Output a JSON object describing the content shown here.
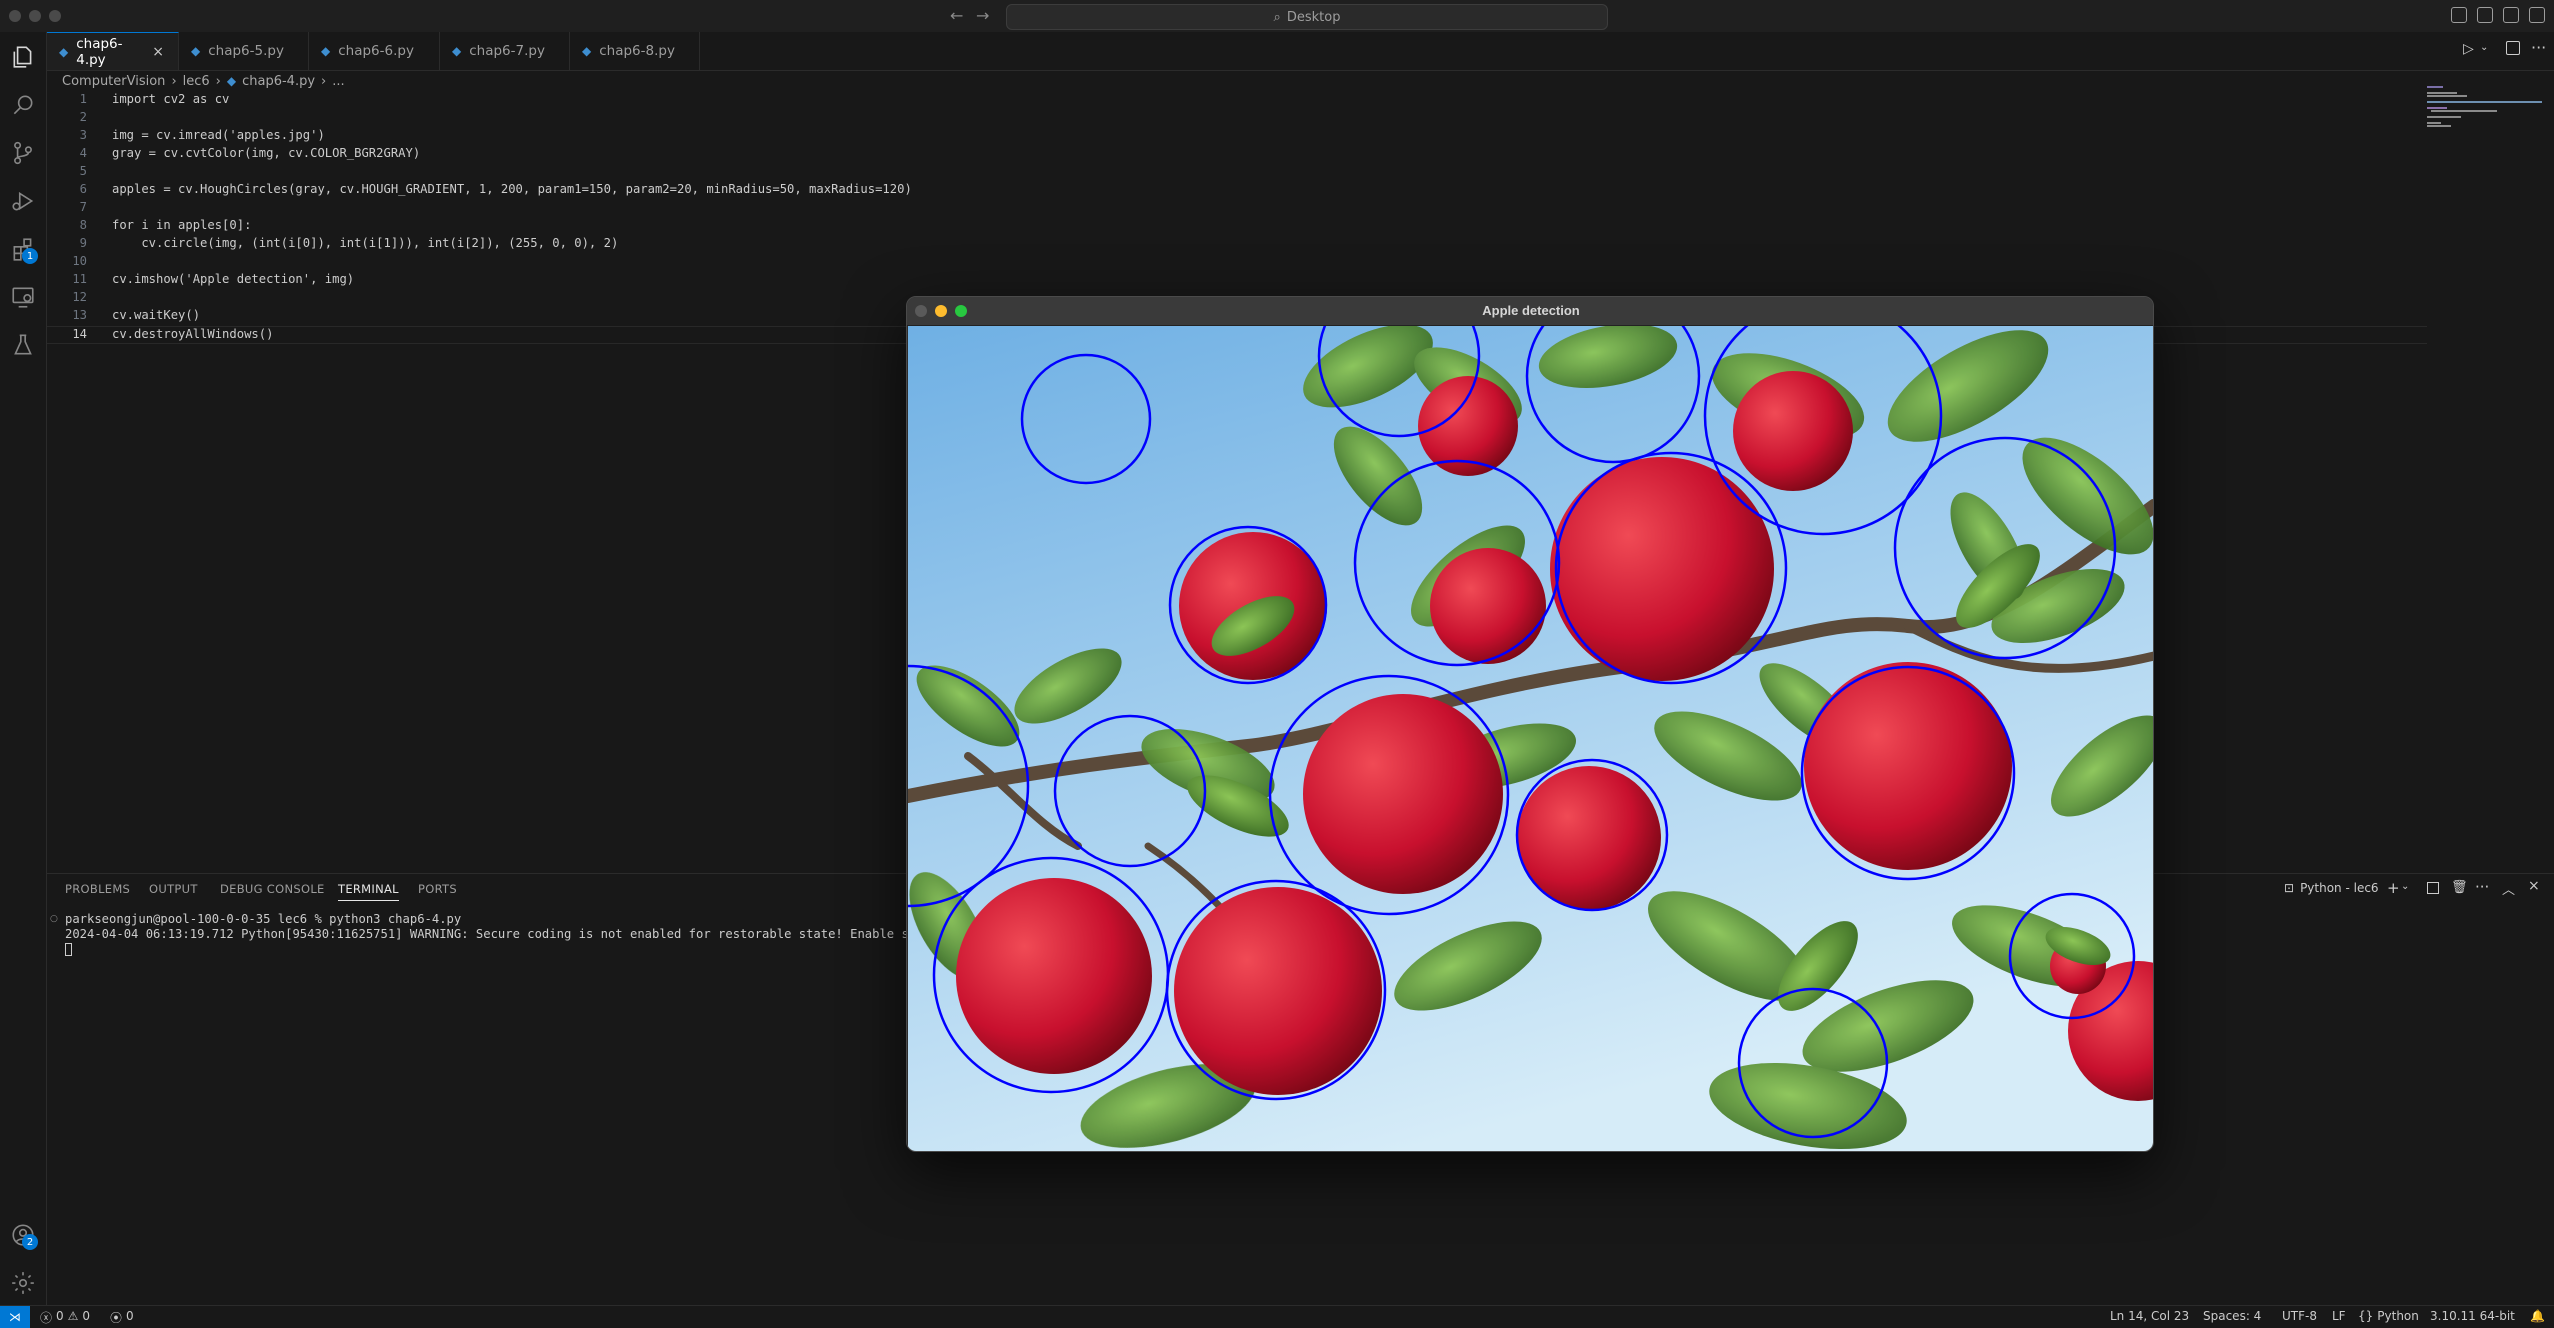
{
  "titlebar": {
    "search_placeholder": "Desktop"
  },
  "activity": {
    "extensions_badge": "1",
    "accounts_badge": "2"
  },
  "tabs": [
    {
      "label": "chap6-4.py",
      "active": true
    },
    {
      "label": "chap6-5.py"
    },
    {
      "label": "chap6-6.py"
    },
    {
      "label": "chap6-7.py"
    },
    {
      "label": "chap6-8.py"
    }
  ],
  "breadcrumb": {
    "folder": "ComputerVision",
    "subfolder": "lec6",
    "file": "chap6-4.py",
    "more": "..."
  },
  "code": {
    "l1": "import cv2 as cv",
    "l3": "img = cv.imread('apples.jpg')",
    "l4": "gray = cv.cvtColor(img, cv.COLOR_BGR2GRAY)",
    "l6": "apples = cv.HoughCircles(gray, cv.HOUGH_GRADIENT, 1, 200, param1=150, param2=20, minRadius=50, maxRadius=120)",
    "l8": "for i in apples[0]:",
    "l9": "    cv.circle(img, (int(i[0]), int(i[1])), int(i[2]), (255, 0, 0), 2)",
    "l11": "cv.imshow('Apple detection', img)",
    "l13": "cv.waitKey()",
    "l14": "cv.destroyAllWindows()"
  },
  "panel": {
    "tabs": [
      "PROBLEMS",
      "OUTPUT",
      "DEBUG CONSOLE",
      "TERMINAL",
      "PORTS"
    ],
    "active_tab": "TERMINAL",
    "terminal_profile": "Python - lec6",
    "terminal_lines": [
      "parkseongjun@pool-100-0-0-35 lec6 % python3 chap6-4.py",
      "2024-04-04 06:13:19.712 Python[95430:11625751] WARNING: Secure coding is not enabled for restorable state! Enable secure"
    ]
  },
  "window": {
    "title": "Apple detection"
  },
  "statusbar": {
    "errors": "0",
    "warnings": "0",
    "ports": "0",
    "position": "Ln 14, Col 23",
    "spaces": "Spaces: 4",
    "encoding": "UTF-8",
    "eol": "LF",
    "language": "Python",
    "interpreter": "3.10.11 64-bit"
  },
  "colors": {
    "accent": "#0078d4",
    "circle": "#0000ff",
    "apple": "#c8102e",
    "sky": "#9fd0ef",
    "leaf": "#3f7d2a"
  }
}
